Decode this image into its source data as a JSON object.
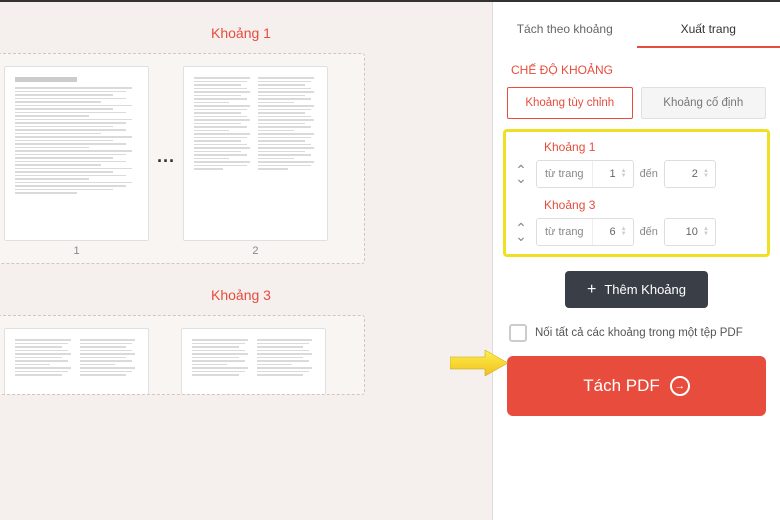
{
  "preview": {
    "ranges": [
      {
        "title": "Khoảng 1",
        "pages": [
          "1",
          "2"
        ],
        "has_dots": true
      },
      {
        "title": "Khoảng 3",
        "pages": [],
        "has_dots": false
      }
    ]
  },
  "sidebar": {
    "tabs": [
      {
        "label": "Tách theo khoảng",
        "active": false
      },
      {
        "label": "Xuất trang",
        "active": true
      }
    ],
    "mode_label": "CHẾ ĐỘ KHOẢNG",
    "mode_buttons": [
      {
        "label": "Khoảng tùy chỉnh",
        "active": true
      },
      {
        "label": "Khoảng cố định",
        "active": false
      }
    ],
    "ranges": [
      {
        "name": "Khoảng 1",
        "from_label": "từ trang",
        "from": "1",
        "to_label": "đến",
        "to": "2"
      },
      {
        "name": "Khoảng 3",
        "from_label": "từ trang",
        "from": "6",
        "to_label": "đến",
        "to": "10"
      }
    ],
    "add_button_label": "Thêm Khoảng",
    "merge_checkbox_label": "Nối tất cả các khoảng trong một tệp PDF",
    "split_button_label": "Tách PDF"
  }
}
